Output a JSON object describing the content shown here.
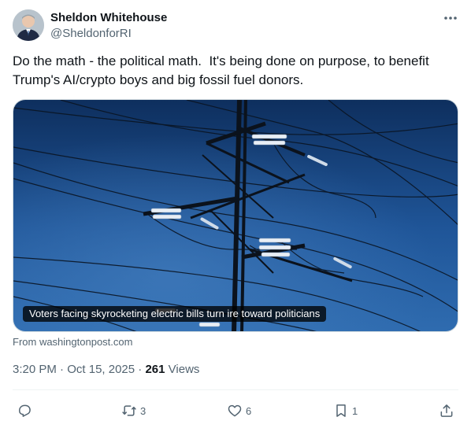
{
  "author": {
    "display_name": "Sheldon Whitehouse",
    "handle": "@SheldonforRI"
  },
  "tweet": {
    "text": "Do the math - the political math.  It's being done on purpose, to benefit Trump's AI/crypto boys and big fossil fuel donors."
  },
  "media": {
    "caption": "Voters facing skyrocketing electric bills turn ire toward politicians",
    "source": "From washingtonpost.com"
  },
  "meta": {
    "time": "3:20 PM",
    "separator1": " · ",
    "date": "Oct 15, 2025",
    "separator2": " · ",
    "views_count": "261",
    "views_label": " Views"
  },
  "actions": {
    "reply_count": "",
    "retweet_count": "3",
    "like_count": "6",
    "bookmark_count": "1"
  },
  "icons": {
    "more": "more-horizontal-icon",
    "reply": "reply-icon",
    "retweet": "retweet-icon",
    "like": "heart-icon",
    "bookmark": "bookmark-icon",
    "share": "share-icon"
  },
  "colors": {
    "text_primary": "#0f1419",
    "text_secondary": "#536471",
    "divider": "#eff3f4",
    "sky_dark": "#123a6e",
    "sky_light": "#2f6fb0"
  }
}
